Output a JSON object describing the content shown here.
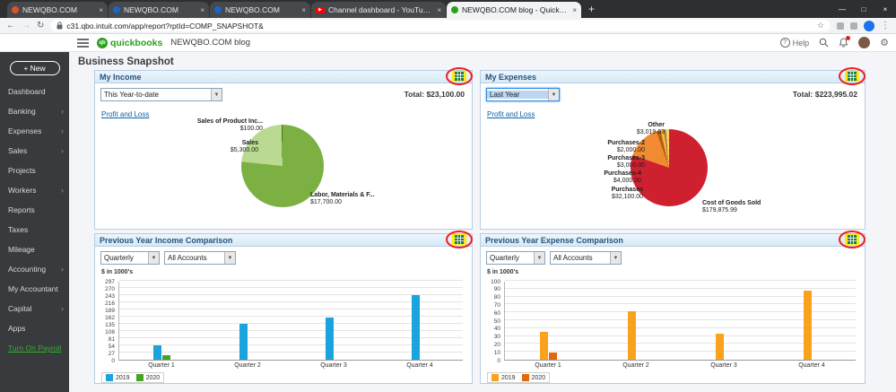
{
  "browser": {
    "tabs": [
      {
        "title": "NEWQBO.COM",
        "favicon_color": "#d8542c",
        "active": false,
        "youtube": false
      },
      {
        "title": "NEWQBO.COM",
        "favicon_color": "#1867c0",
        "active": false,
        "youtube": false
      },
      {
        "title": "NEWQBO.COM",
        "favicon_color": "#1867c0",
        "active": false,
        "youtube": false
      },
      {
        "title": "Channel dashboard - YouTube St",
        "favicon_color": "#ff0000",
        "active": false,
        "youtube": true
      },
      {
        "title": "NEWQBO.COM blog - QuickBoo...",
        "favicon_color": "#2ca01c",
        "active": true,
        "youtube": false
      }
    ],
    "url": "c31.qbo.intuit.com/app/report?rptId=COMP_SNAPSHOT&"
  },
  "icons": {
    "hamburger": "≡",
    "back": "←",
    "forward": "→",
    "refresh": "↻",
    "star": "☆",
    "kebab": "⋮",
    "gear": "⚙",
    "close": "×",
    "new_tab": "+",
    "minimize": "—",
    "maximize": "□",
    "chevron": "›",
    "caret": "▼",
    "help": "?",
    "play": "▶"
  },
  "app_header": {
    "brand_badge": "qb",
    "brand": "quickbooks",
    "company": "NEWQBO.COM blog",
    "help_label": "Help"
  },
  "sidebar": {
    "new_button": "+ New",
    "items": [
      {
        "label": "Dashboard",
        "expandable": false
      },
      {
        "label": "Banking",
        "expandable": true
      },
      {
        "label": "Expenses",
        "expandable": true
      },
      {
        "label": "Sales",
        "expandable": true
      },
      {
        "label": "Projects",
        "expandable": false
      },
      {
        "label": "Workers",
        "expandable": true
      },
      {
        "label": "Reports",
        "expandable": false
      },
      {
        "label": "Taxes",
        "expandable": false
      },
      {
        "label": "Mileage",
        "expandable": false
      },
      {
        "label": "Accounting",
        "expandable": true
      },
      {
        "label": "My Accountant",
        "expandable": false
      },
      {
        "label": "Capital",
        "expandable": true
      },
      {
        "label": "Apps",
        "expandable": false
      },
      {
        "label": "Turn On Payroll",
        "expandable": false,
        "highlight": true
      }
    ]
  },
  "main": {
    "page_title": "Business Snapshot"
  },
  "panels": {
    "income": {
      "title": "My Income",
      "period": "This Year-to-date",
      "total": "Total: $23,100.00",
      "link": "Profit and Loss"
    },
    "expenses": {
      "title": "My Expenses",
      "period": "Last Year",
      "total": "Total: $223,995.02",
      "link": "Profit and Loss"
    },
    "income_comparison": {
      "title": "Previous Year Income Comparison",
      "frequency": "Quarterly",
      "accounts": "All Accounts"
    },
    "expense_comparison": {
      "title": "Previous Year Expense Comparison",
      "frequency": "Quarterly",
      "accounts": "All Accounts"
    }
  },
  "chart_data": [
    {
      "id": "income-pie",
      "type": "pie",
      "title": "My Income",
      "period": "This Year-to-date",
      "total": 23100,
      "slices": [
        {
          "label": "Labor, Materials & F...",
          "value": 17700,
          "value_label": "$17,700.00",
          "color": "#7cb043"
        },
        {
          "label": "Sales",
          "value": 5300,
          "value_label": "$5,300.00",
          "color": "#b9da90"
        },
        {
          "label": "Sales of Product Inc...",
          "value": 100,
          "value_label": "$100.00",
          "color": "#3f7d1e"
        }
      ]
    },
    {
      "id": "expenses-pie",
      "type": "pie",
      "title": "My Expenses",
      "period": "Last Year",
      "total": 223995.02,
      "slices": [
        {
          "label": "Cost of Goods Sold",
          "value": 179875.99,
          "value_label": "$179,875.99",
          "color": "#cf2030"
        },
        {
          "label": "Purchases",
          "value": 32100,
          "value_label": "$32,100.00",
          "color": "#f08b33"
        },
        {
          "label": "Purchases-4",
          "value": 4000,
          "value_label": "$4,000.00",
          "color": "#b85c12"
        },
        {
          "label": "Purchases-3",
          "value": 3000,
          "value_label": "$3,000.00",
          "color": "#f6b93f"
        },
        {
          "label": "Purchases-2",
          "value": 2000,
          "value_label": "$2,000.00",
          "color": "#9c7b52"
        },
        {
          "label": "Other",
          "value": 3019.03,
          "value_label": "$3,019.03",
          "color": "#fdd35c"
        }
      ]
    },
    {
      "id": "income-comparison",
      "type": "bar",
      "title": "Previous Year Income Comparison",
      "ylabel": "$ in 1000's",
      "ticks": [
        0,
        27,
        54,
        81,
        108,
        135,
        162,
        189,
        216,
        243,
        270,
        297
      ],
      "ylim": [
        0,
        297
      ],
      "grid": true,
      "legend_position": "bottom-left",
      "categories": [
        "Quarter 1",
        "Quarter 2",
        "Quarter 3",
        "Quarter 4"
      ],
      "series": [
        {
          "name": "2019",
          "color": "#1ba3dd",
          "values": [
            55,
            135,
            162,
            245
          ]
        },
        {
          "name": "2020",
          "color": "#47a226",
          "values": [
            16,
            0,
            0,
            0
          ]
        }
      ]
    },
    {
      "id": "expense-comparison",
      "type": "bar",
      "title": "Previous Year Expense Comparison",
      "ylabel": "$ in 1000's",
      "ticks": [
        0,
        10,
        20,
        30,
        40,
        50,
        60,
        70,
        80,
        90,
        100
      ],
      "ylim": [
        0,
        100
      ],
      "grid": true,
      "legend_position": "bottom-left",
      "categories": [
        "Quarter 1",
        "Quarter 2",
        "Quarter 3",
        "Quarter 4"
      ],
      "series": [
        {
          "name": "2019",
          "color": "#f9a21d",
          "values": [
            36,
            62,
            33,
            89
          ]
        },
        {
          "name": "2020",
          "color": "#e2690b",
          "values": [
            9,
            0,
            0,
            0
          ]
        }
      ]
    }
  ]
}
